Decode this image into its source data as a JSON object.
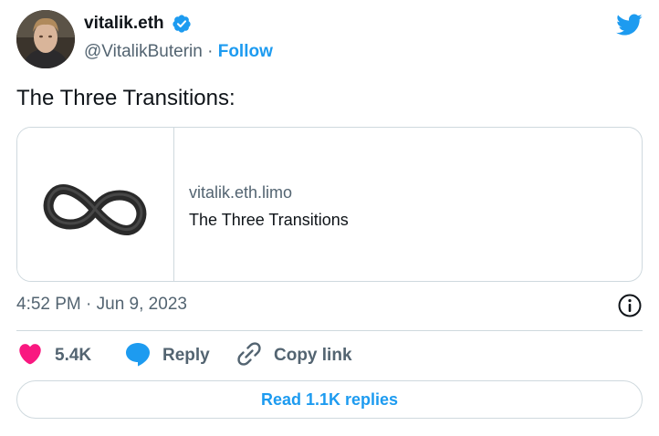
{
  "author": {
    "display_name": "vitalik.eth",
    "handle": "@VitalikButerin",
    "separator": "·",
    "follow_label": "Follow"
  },
  "tweet": {
    "text": "The Three Transitions:"
  },
  "card": {
    "domain": "vitalik.eth.limo",
    "title": "The Three Transitions"
  },
  "timestamp": "4:52 PM · Jun 9, 2023",
  "actions": {
    "like_count": "5.4K",
    "reply_label": "Reply",
    "copy_label": "Copy link"
  },
  "read_replies_label": "Read 1.1K replies",
  "icons": {
    "brand": "twitter-bird-icon",
    "verified": "verified-badge-icon",
    "info": "info-icon",
    "like": "heart-icon",
    "reply": "speech-bubble-icon",
    "copy": "link-icon",
    "card_image": "infinity-icon"
  },
  "colors": {
    "accent": "#1d9bf0",
    "like": "#f91880",
    "text_primary": "#0f1419",
    "text_secondary": "#536471",
    "border": "#cfd9de"
  }
}
